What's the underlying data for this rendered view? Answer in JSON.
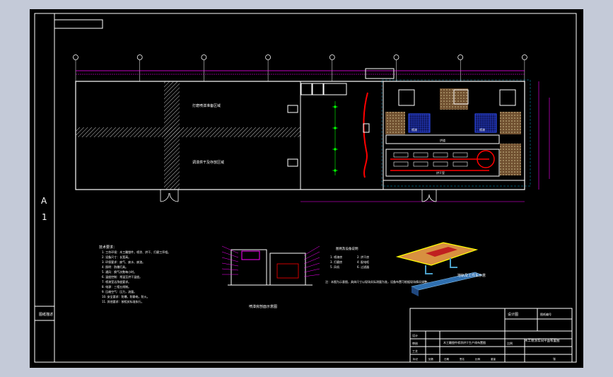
{
  "drawing": {
    "sheet_size_letter": "A",
    "sheet_size_number": "1",
    "left_margin_label": "图纸描述",
    "colors": {
      "background": "#000000",
      "frame": "#ffffff",
      "dimension": "#ff00ff",
      "wall": "#ffffff",
      "hatch": "#c8c8c8",
      "green_mark": "#00ff00",
      "red_equipment": "#ff0000",
      "blue_equipment": "#3050ff",
      "yellow_platform": "#ffff00",
      "orange_platform": "#d89040",
      "cyan_outline": "#00c8ff"
    }
  },
  "plan": {
    "zone_top_label": "打磨喷漆准备区域",
    "zone_bottom_label": "调漆烘干及存放区域",
    "room_label": "配电室",
    "booth_label_left": "喷漆",
    "booth_label_right": "喷漆",
    "center_label": "烘道",
    "bottom_label": "烘干室",
    "axis_marks_count": 8
  },
  "notes": {
    "title": "技术要求：",
    "items": [
      "1. 工作环境：木工雕塑件，喷涂、烘干、打磨工序相。",
      "2. 设备尺寸：长宽高。",
      "3. 环保要求：废气、废水、废渣。",
      "4. 照明：防爆灯具。",
      "5. 通风：换气次数每小时。",
      "6. 温度控制：常温至烘干温度。",
      "7. 喷漆室洁净度要求。",
      "8. 电源：三相五线制。",
      "9. 压缩空气：压力，流量。",
      "10. 安全要求：防爆，防静电，防火。",
      "11. 其他要求：按相关标准执行。"
    ]
  },
  "section_view": {
    "caption": "喷漆房剖面示意图"
  },
  "legend": {
    "title": "图例及设备说明",
    "items": [
      "1. 喷漆房",
      "2. 烘干房",
      "3. 打磨房",
      "4. 配电柜",
      "5. 风机",
      "6. 过滤器"
    ],
    "note": "注：本图为示意图，具体尺寸以现场实际测量为准，设备布置可根据现场情况调整。"
  },
  "iso_view": {
    "caption": "地轨及工件车示意"
  },
  "title_block": {
    "top_left": "设计图",
    "top_right": "图纸编号",
    "drawing_name": "木工喷涂车间平面布置图",
    "subtitle": "木工雕塑件喷涂烘干生产线布置图",
    "row_labels": [
      "设计",
      "审核",
      "工艺"
    ],
    "scale_label": "比例",
    "sheet_label": "张",
    "bottom_cells": [
      "标记",
      "处数",
      "日期",
      "签名",
      "比例",
      "重量"
    ]
  }
}
